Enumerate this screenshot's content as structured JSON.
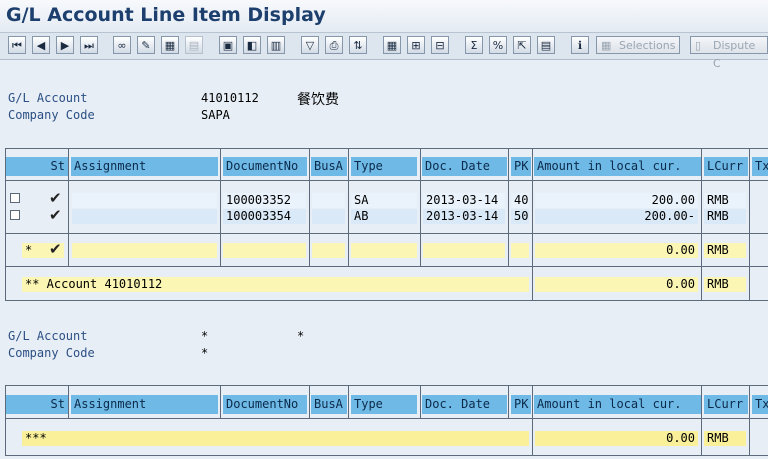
{
  "window": {
    "title": "G/L Account Line Item Display"
  },
  "toolbar": {
    "buttons": [
      "first-page",
      "prev-page",
      "next-page",
      "last-page",
      "choose-layout",
      "edit",
      "select-all",
      "deselect",
      "display-document",
      "change-document",
      "doc-overview",
      "filter",
      "print",
      "sort",
      "layout",
      "subtotal",
      "export",
      "sum",
      "mail",
      "spreadsheet",
      "info"
    ],
    "selections_label": "Selections",
    "dispute_label": "Dispute C"
  },
  "header1": {
    "gl_label": "G/L Account",
    "gl_value": "41010112",
    "gl_text": "餐饮费",
    "cc_label": "Company Code",
    "cc_value": "SAPA"
  },
  "columns": [
    "St",
    "Assignment",
    "DocumentNo",
    "BusA",
    "Type",
    "Doc. Date",
    "PK",
    "Amount in local cur.",
    "LCurr",
    "Tx"
  ],
  "rows": [
    {
      "documentno": "100003352",
      "type": "SA",
      "date": "2013-03-14",
      "pk": "40",
      "amount": "200.00",
      "curr": "RMB"
    },
    {
      "documentno": "100003354",
      "type": "AB",
      "date": "2013-03-14",
      "pk": "50",
      "amount": "200.00-",
      "curr": "RMB"
    }
  ],
  "subtotal": {
    "marker": "*",
    "amount": "0.00",
    "curr": "RMB"
  },
  "account_total": {
    "label": "** Account 41010112",
    "amount": "0.00",
    "curr": "RMB"
  },
  "header2": {
    "gl_label": "G/L Account",
    "gl_value": "*",
    "gl_text": "*",
    "cc_label": "Company Code",
    "cc_value": "*"
  },
  "grand_total": {
    "label": "***",
    "amount": "0.00",
    "curr": "RMB"
  },
  "icons": {
    "status_done": "checkmark-icon"
  }
}
